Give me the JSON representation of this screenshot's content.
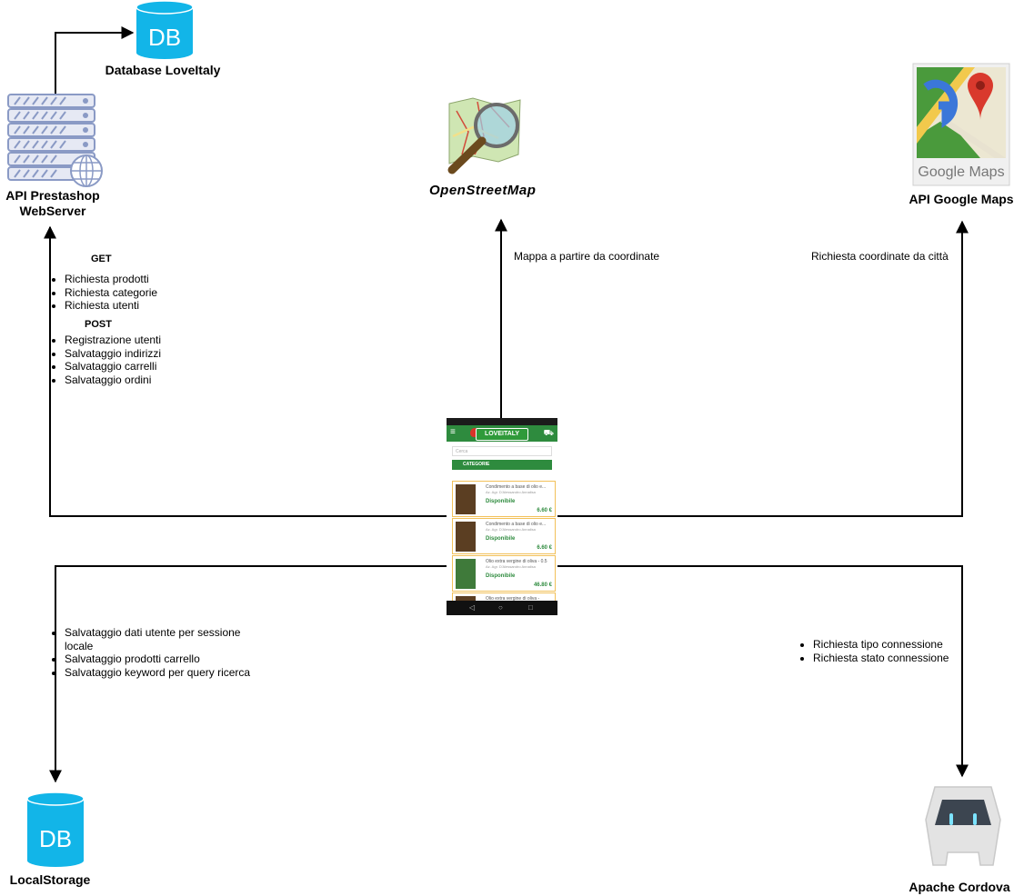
{
  "nodes": {
    "db_top": {
      "icon_text": "DB",
      "label": "Database LoveItaly"
    },
    "server": {
      "label_line1": "API Prestashop",
      "label_line2": "WebServer"
    },
    "osm": {
      "label": "OpenStreetMap"
    },
    "gmaps": {
      "logo_text": "Google Maps",
      "label": "API Google Maps"
    },
    "local_storage": {
      "icon_text": "DB",
      "label": "LocalStorage"
    },
    "cordova": {
      "label": "Apache Cordova"
    }
  },
  "edges": {
    "server_get_header": "GET",
    "server_get_items": [
      "Richiesta prodotti",
      "Richiesta categorie",
      "Richiesta utenti"
    ],
    "server_post_header": "POST",
    "server_post_items": [
      "Registrazione utenti",
      "Salvataggio indirizzi",
      "Salvataggio carrelli",
      "Salvataggio ordini"
    ],
    "osm_label": "Mappa a partire da coordinate",
    "gmaps_label": "Richiesta coordinate da città",
    "local_items": [
      "Salvataggio dati utente per sessione locale",
      "Salvataggio prodotti carrello",
      "Salvataggio keyword per query ricerca"
    ],
    "cordova_items": [
      "Richiesta tipo connessione",
      "Richiesta stato connessione"
    ]
  },
  "phone": {
    "logo": "LOVEITALY",
    "search_placeholder": "Cerca",
    "category_button": "CATEGORIE",
    "products": [
      {
        "name": "Condimento a base di olio e...",
        "producer": "Az. Agr. D'Alessandro Annalisa",
        "status": "Disponibile",
        "price": "6.60 €"
      },
      {
        "name": "Condimento a base di olio e...",
        "producer": "Az. Agr. D'Alessandro Annalisa",
        "status": "Disponibile",
        "price": "6.60 €"
      },
      {
        "name": "Olio extra vergine di oliva - 0.5",
        "producer": "Az. Agr. D'Alessandro Annalisa",
        "status": "Disponibile",
        "price": "46.80 €"
      },
      {
        "name": "Olio extra vergine di oliva -",
        "producer": "",
        "status": "",
        "price": ""
      }
    ]
  },
  "colors": {
    "db_cyan": "#12b5e8",
    "server_blue": "#8a9ac5",
    "app_green": "#2e8b3e",
    "cordova_gray": "#e3e3e3"
  }
}
